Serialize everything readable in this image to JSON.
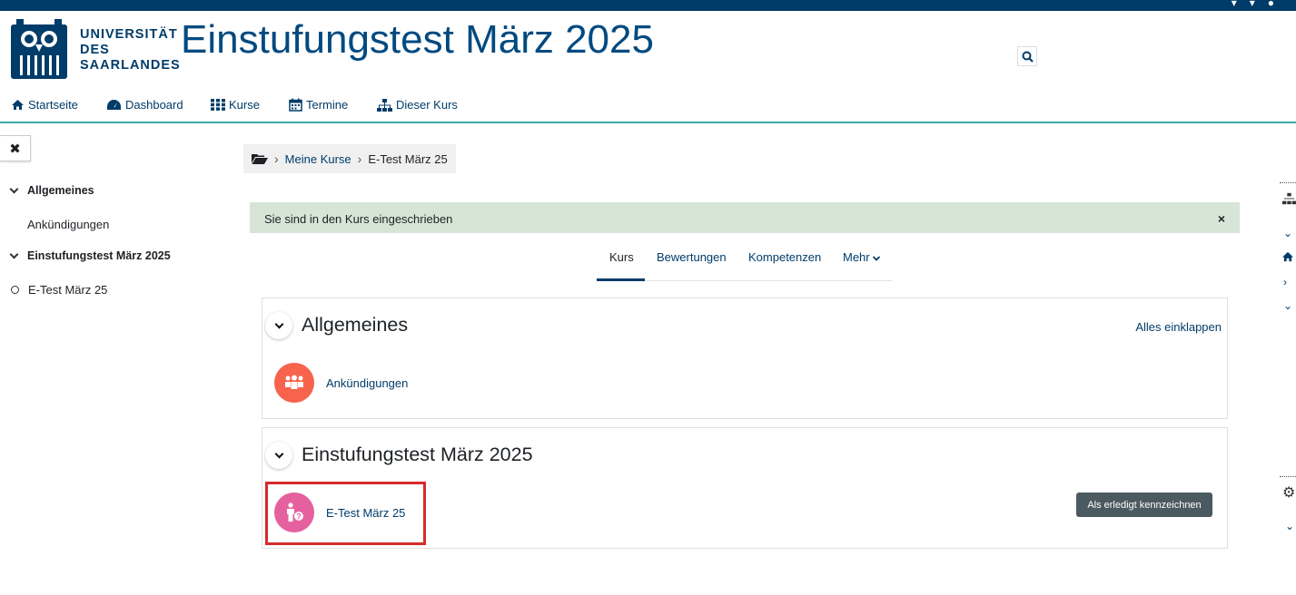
{
  "header": {
    "logo_lines": [
      "UNIVERSITÄT",
      "DES",
      "SAARLANDES"
    ],
    "site_title": "Einstufungstest März 2025"
  },
  "nav": {
    "items": [
      {
        "label": "Startseite",
        "icon": "home-icon"
      },
      {
        "label": "Dashboard",
        "icon": "dashboard-icon"
      },
      {
        "label": "Kurse",
        "icon": "grid-icon"
      },
      {
        "label": "Termine",
        "icon": "calendar-icon"
      },
      {
        "label": "Dieser Kurs",
        "icon": "sitemap-icon"
      }
    ]
  },
  "drawer": {
    "close_glyph": "✖",
    "items": [
      {
        "label": "Allgemeines",
        "type": "section"
      },
      {
        "label": "Ankündigungen",
        "type": "activity"
      },
      {
        "label": "Einstufungstest März 2025",
        "type": "section"
      },
      {
        "label": "E-Test März 25",
        "type": "activity"
      }
    ]
  },
  "breadcrumb": {
    "items": [
      "Meine Kurse",
      "E-Test März 25"
    ],
    "separator": "›"
  },
  "alert": {
    "message": "Sie sind in den Kurs eingeschrieben",
    "close": "×"
  },
  "tabs": {
    "items": [
      "Kurs",
      "Bewertungen",
      "Kompetenzen",
      "Mehr"
    ],
    "active": "Kurs"
  },
  "sections": [
    {
      "title": "Allgemeines",
      "collapse_all": "Alles einklappen",
      "activity": {
        "label": "Ankündigungen",
        "icon": "forum-icon",
        "color": "#f7634d"
      }
    },
    {
      "title": "Einstufungstest März 2025",
      "activity": {
        "label": "E-Test März 25",
        "icon": "quiz-icon",
        "color": "#e5609e"
      },
      "done_button": "Als erledigt kennzeichnen"
    }
  ],
  "colors": {
    "brand": "#003c69",
    "accent_line": "#3aa9a3",
    "alert_bg": "#d6e5d6",
    "highlight": "#d62b2b"
  }
}
